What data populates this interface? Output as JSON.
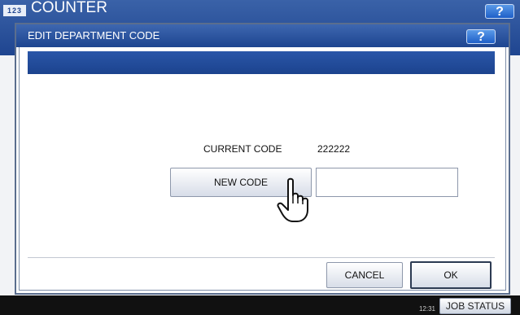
{
  "app": {
    "icon_text": "123",
    "title": "COUNTER",
    "help_label": "?"
  },
  "dialog": {
    "title": "EDIT DEPARTMENT CODE",
    "help_label": "?",
    "current_code_label": "CURRENT CODE",
    "current_code_value": "222222",
    "new_code_button": "NEW CODE",
    "new_code_value": "",
    "cancel_button": "CANCEL",
    "ok_button": "OK"
  },
  "statusbar": {
    "time": "12:31",
    "job_status_button": "JOB STATUS"
  },
  "icons": {
    "pointer": "hand-pointer-icon"
  }
}
